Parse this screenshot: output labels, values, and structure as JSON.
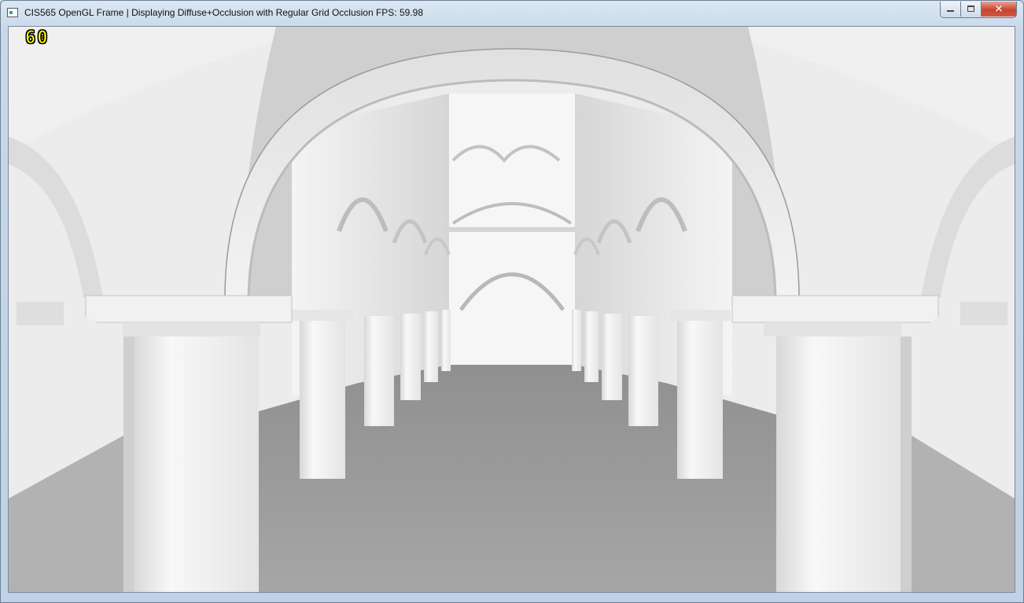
{
  "window": {
    "title": "CIS565 OpenGL Frame | Displaying Diffuse+Occlusion with Regular Grid Occlusion FPS: 59.98",
    "icon": "opengl-app-icon"
  },
  "controls": {
    "minimize_icon": "minimize-icon",
    "restore_icon": "restore-icon",
    "close_icon": "close-icon",
    "close_glyph": "✕"
  },
  "viewport": {
    "fps_overlay": "60",
    "scene": "rendered-3d-scene",
    "colors": {
      "overlay_text": "#ffff00",
      "floor": "#9c9c9c",
      "wall": "#e9e9e9"
    }
  }
}
